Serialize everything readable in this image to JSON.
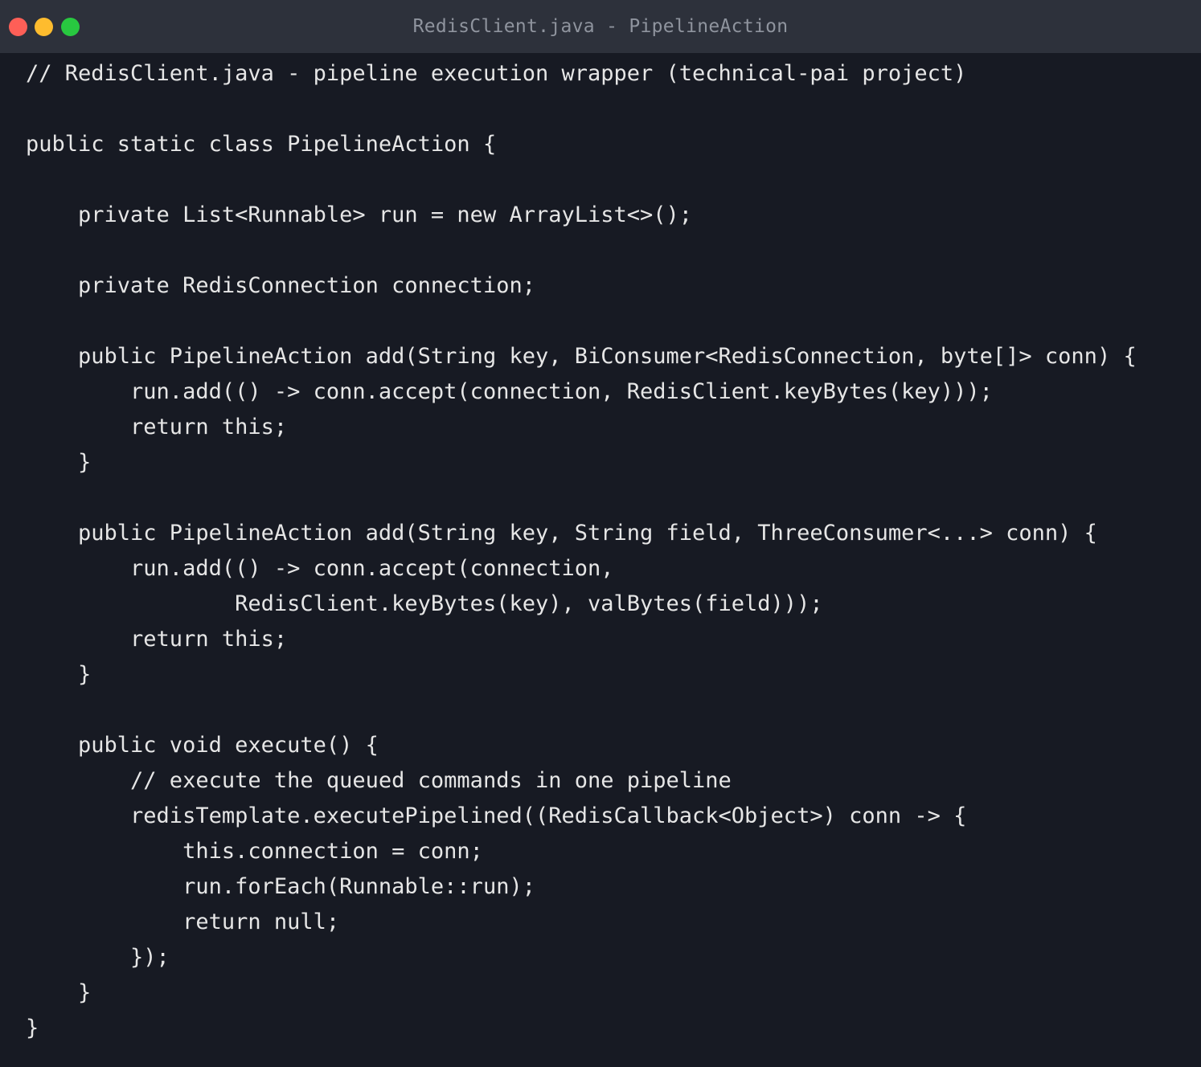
{
  "window": {
    "title": "RedisClient.java - PipelineAction",
    "traffic_lights": {
      "close_color": "#fe5f57",
      "minimize_color": "#febc2e",
      "maximize_color": "#28c840"
    }
  },
  "colors": {
    "background": "#171a23",
    "titlebar": "#2d313b",
    "code_text": "#e6e6e6",
    "title_text": "#8f949e"
  },
  "code": {
    "language": "java",
    "lines": [
      "// RedisClient.java - pipeline execution wrapper (technical-pai project)",
      "",
      "public static class PipelineAction {",
      "",
      "    private List<Runnable> run = new ArrayList<>();",
      "",
      "    private RedisConnection connection;",
      "",
      "    public PipelineAction add(String key, BiConsumer<RedisConnection, byte[]> conn) {",
      "        run.add(() -> conn.accept(connection, RedisClient.keyBytes(key)));",
      "        return this;",
      "    }",
      "",
      "    public PipelineAction add(String key, String field, ThreeConsumer<...> conn) {",
      "        run.add(() -> conn.accept(connection,",
      "                RedisClient.keyBytes(key), valBytes(field)));",
      "        return this;",
      "    }",
      "",
      "    public void execute() {",
      "        // execute the queued commands in one pipeline",
      "        redisTemplate.executePipelined((RedisCallback<Object>) conn -> {",
      "            this.connection = conn;",
      "            run.forEach(Runnable::run);",
      "            return null;",
      "        });",
      "    }",
      "}"
    ]
  }
}
